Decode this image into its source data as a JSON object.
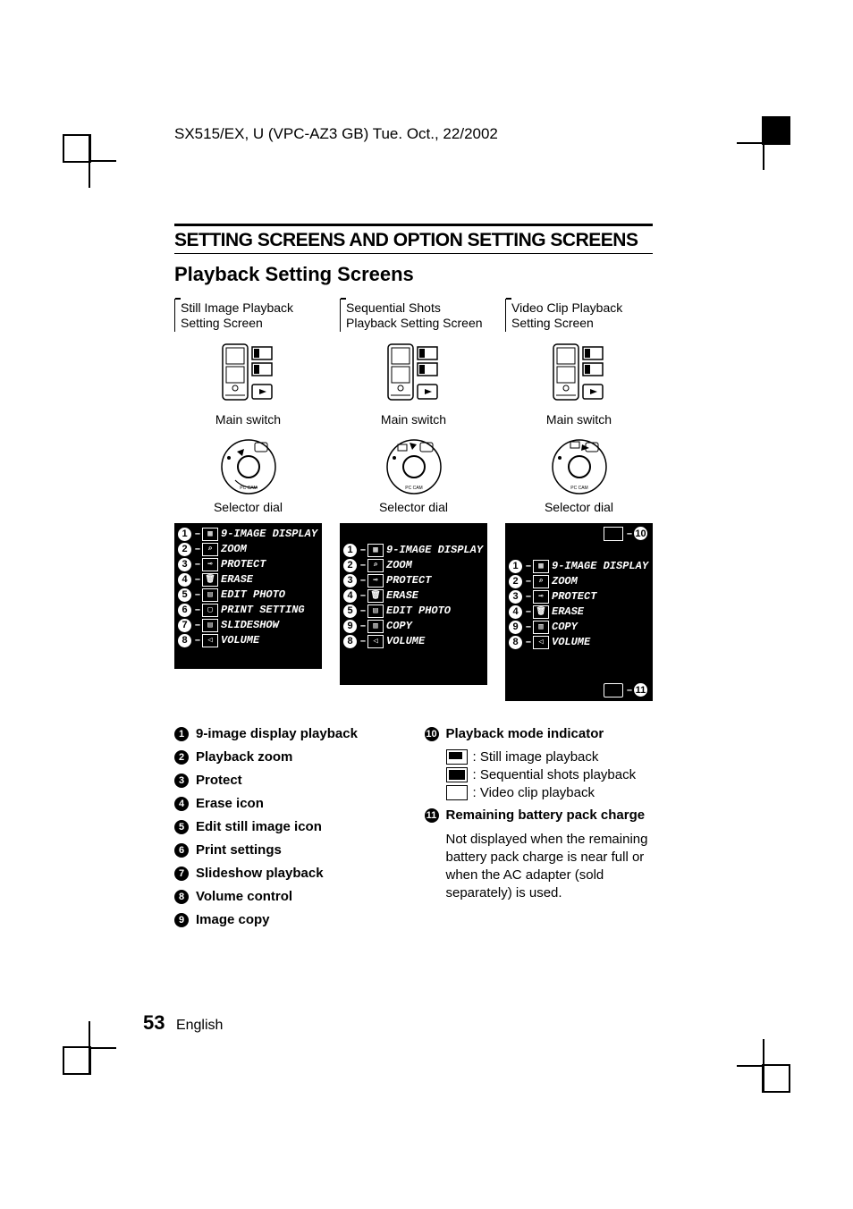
{
  "header": "SX515/EX, U (VPC-AZ3 GB)    Tue. Oct., 22/2002",
  "section_title": "SETTING SCREENS AND OPTION SETTING SCREENS",
  "sub_title": "Playback Setting Screens",
  "columns": [
    {
      "label": "Still Image Playback Setting Screen",
      "main_switch": "Main switch",
      "selector": "Selector dial"
    },
    {
      "label": "Sequential Shots Playback Setting Screen",
      "main_switch": "Main switch",
      "selector": "Selector dial"
    },
    {
      "label": "Video Clip Playback Setting Screen",
      "main_switch": "Main switch",
      "selector": "Selector dial"
    }
  ],
  "screen1": {
    "items": [
      {
        "n": "1",
        "text": "9-IMAGE DISPLAY"
      },
      {
        "n": "2",
        "text": "ZOOM"
      },
      {
        "n": "3",
        "text": "PROTECT"
      },
      {
        "n": "4",
        "text": "ERASE"
      },
      {
        "n": "5",
        "text": "EDIT PHOTO"
      },
      {
        "n": "6",
        "text": "PRINT SETTING"
      },
      {
        "n": "7",
        "text": "SLIDESHOW"
      },
      {
        "n": "8",
        "text": "VOLUME"
      }
    ]
  },
  "screen2": {
    "items": [
      {
        "n": "1",
        "text": "9-IMAGE DISPLAY"
      },
      {
        "n": "2",
        "text": "ZOOM"
      },
      {
        "n": "3",
        "text": "PROTECT"
      },
      {
        "n": "4",
        "text": "ERASE"
      },
      {
        "n": "5",
        "text": "EDIT PHOTO"
      },
      {
        "n": "9",
        "text": "COPY"
      },
      {
        "n": "8",
        "text": "VOLUME"
      }
    ]
  },
  "screen3": {
    "items": [
      {
        "n": "1",
        "text": "9-IMAGE DISPLAY"
      },
      {
        "n": "2",
        "text": "ZOOM"
      },
      {
        "n": "3",
        "text": "PROTECT"
      },
      {
        "n": "4",
        "text": "ERASE"
      },
      {
        "n": "9",
        "text": "COPY"
      },
      {
        "n": "8",
        "text": "VOLUME"
      }
    ],
    "ind10": "10",
    "ind11": "11"
  },
  "legend_left": [
    {
      "n": "1",
      "label": "9-image display playback"
    },
    {
      "n": "2",
      "label": "Playback zoom"
    },
    {
      "n": "3",
      "label": "Protect"
    },
    {
      "n": "4",
      "label": "Erase icon"
    },
    {
      "n": "5",
      "label": "Edit still image icon"
    },
    {
      "n": "6",
      "label": "Print settings"
    },
    {
      "n": "7",
      "label": "Slideshow playback"
    },
    {
      "n": "8",
      "label": "Volume control"
    },
    {
      "n": "9",
      "label": "Image copy"
    }
  ],
  "legend_right": {
    "item10": {
      "n": "10",
      "label": "Playback mode indicator",
      "subs": [
        ": Still image playback",
        ": Sequential shots playback",
        ": Video clip playback"
      ]
    },
    "item11": {
      "n": "11",
      "label": "Remaining battery pack charge",
      "body": "Not displayed when the remaining battery pack charge is near full or when the AC adapter (sold separately) is used."
    }
  },
  "footer": {
    "page": "53",
    "lang": "English"
  }
}
